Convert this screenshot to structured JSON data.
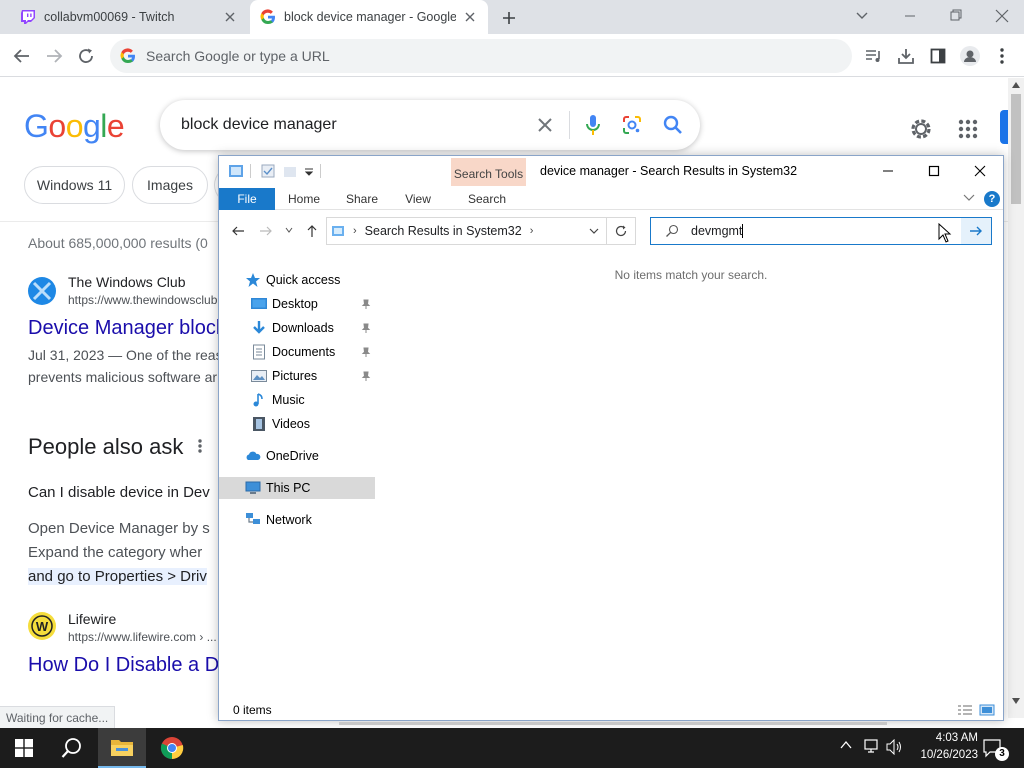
{
  "browser": {
    "tabs": [
      {
        "title": "collabvm00069 - Twitch",
        "active": false,
        "favicon": "twitch-icon"
      },
      {
        "title": "block device manager - Google S",
        "active": true,
        "favicon": "google-icon"
      }
    ],
    "omnibox_placeholder": "Search Google or type a URL",
    "status": "Waiting for cache..."
  },
  "google": {
    "logo": "Google",
    "query": "block device manager",
    "chips": [
      "Windows 11",
      "Images"
    ],
    "results_count": "About 685,000,000 results (0",
    "result1": {
      "site": "The Windows Club",
      "url": "https://www.thewindowsclub",
      "title": "Device Manager block",
      "snippet_line1": "Jul 31, 2023 — One of the reas",
      "snippet_line2": "prevents malicious software ar"
    },
    "people_also_ask": "People also ask",
    "paa_question": "Can I disable device in Dev",
    "paa_answer_line1": "Open Device Manager by s",
    "paa_answer_line2": "Expand the category wher",
    "paa_answer_line3": "and go to Properties > Driv",
    "result2": {
      "site": "Lifewire",
      "url": "https://www.lifewire.com › ...",
      "title": "How Do I Disable a D"
    }
  },
  "explorer": {
    "title": "device manager - Search Results in System32",
    "contextual_tab": "Search Tools",
    "ribbon_tabs": [
      "File",
      "Home",
      "Share",
      "View",
      "Search"
    ],
    "address_path": "Search Results in System32",
    "search_value": "devmgmt",
    "nav_items": {
      "quick_access": "Quick access",
      "desktop": "Desktop",
      "downloads": "Downloads",
      "documents": "Documents",
      "pictures": "Pictures",
      "music": "Music",
      "videos": "Videos",
      "onedrive": "OneDrive",
      "this_pc": "This PC",
      "network": "Network"
    },
    "empty_message": "No items match your search.",
    "item_count": "0 items"
  },
  "taskbar": {
    "time": "4:03 AM",
    "date": "10/26/2023",
    "notification_count": "3"
  },
  "colors": {
    "accent_blue": "#1979ca",
    "google_link": "#1a0dab",
    "taskbar": "#1c1c1c"
  }
}
